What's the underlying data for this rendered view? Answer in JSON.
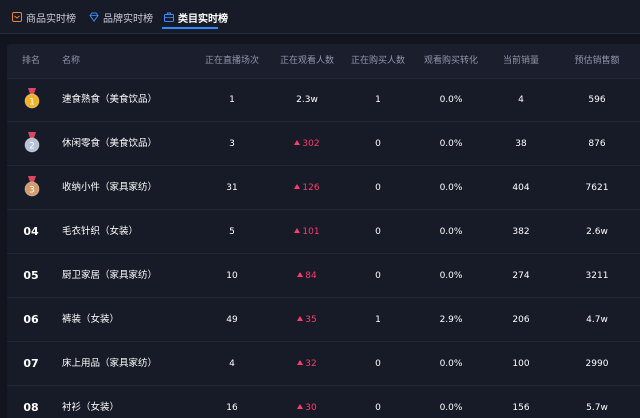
{
  "tabs": [
    {
      "label": "商品实时榜",
      "icon": "product-icon",
      "active": false
    },
    {
      "label": "品牌实时榜",
      "icon": "diamond-icon",
      "active": false
    },
    {
      "label": "类目实时榜",
      "icon": "briefcase-icon",
      "active": true
    }
  ],
  "colors": {
    "accent": "#2f8cff",
    "up": "#ff3b6b",
    "gold": "#f2b327",
    "silver": "#b8c2d6",
    "bronze": "#d59b6c"
  },
  "columns": [
    "排名",
    "名称",
    "正在直播场次",
    "正在观看人数",
    "正在购买人数",
    "观看购买转化",
    "当前销量",
    "预估销售额"
  ],
  "rows": [
    {
      "rank": "1",
      "medal": "gold",
      "name": "速食熟食（美食饮品）",
      "live": "1",
      "viewers": "2.3w",
      "viewers_up": false,
      "buyers": "1",
      "conversion": "0.0%",
      "sales": "4",
      "revenue": "596"
    },
    {
      "rank": "2",
      "medal": "silver",
      "name": "休闲零食（美食饮品）",
      "live": "3",
      "viewers": "302",
      "viewers_up": true,
      "buyers": "0",
      "conversion": "0.0%",
      "sales": "38",
      "revenue": "876"
    },
    {
      "rank": "3",
      "medal": "bronze",
      "name": "收纳小件（家具家纺）",
      "live": "31",
      "viewers": "126",
      "viewers_up": true,
      "buyers": "0",
      "conversion": "0.0%",
      "sales": "404",
      "revenue": "7621"
    },
    {
      "rank": "04",
      "medal": "",
      "name": "毛衣针织（女装）",
      "live": "5",
      "viewers": "101",
      "viewers_up": true,
      "buyers": "0",
      "conversion": "0.0%",
      "sales": "382",
      "revenue": "2.6w"
    },
    {
      "rank": "05",
      "medal": "",
      "name": "厨卫家居（家具家纺）",
      "live": "10",
      "viewers": "84",
      "viewers_up": true,
      "buyers": "0",
      "conversion": "0.0%",
      "sales": "274",
      "revenue": "3211"
    },
    {
      "rank": "06",
      "medal": "",
      "name": "裤装（女装）",
      "live": "49",
      "viewers": "35",
      "viewers_up": true,
      "buyers": "1",
      "conversion": "2.9%",
      "sales": "206",
      "revenue": "4.7w"
    },
    {
      "rank": "07",
      "medal": "",
      "name": "床上用品（家具家纺）",
      "live": "4",
      "viewers": "32",
      "viewers_up": true,
      "buyers": "0",
      "conversion": "0.0%",
      "sales": "100",
      "revenue": "2990"
    },
    {
      "rank": "08",
      "medal": "",
      "name": "衬衫（女装）",
      "live": "16",
      "viewers": "30",
      "viewers_up": true,
      "buyers": "0",
      "conversion": "0.0%",
      "sales": "156",
      "revenue": "5.7w"
    }
  ]
}
